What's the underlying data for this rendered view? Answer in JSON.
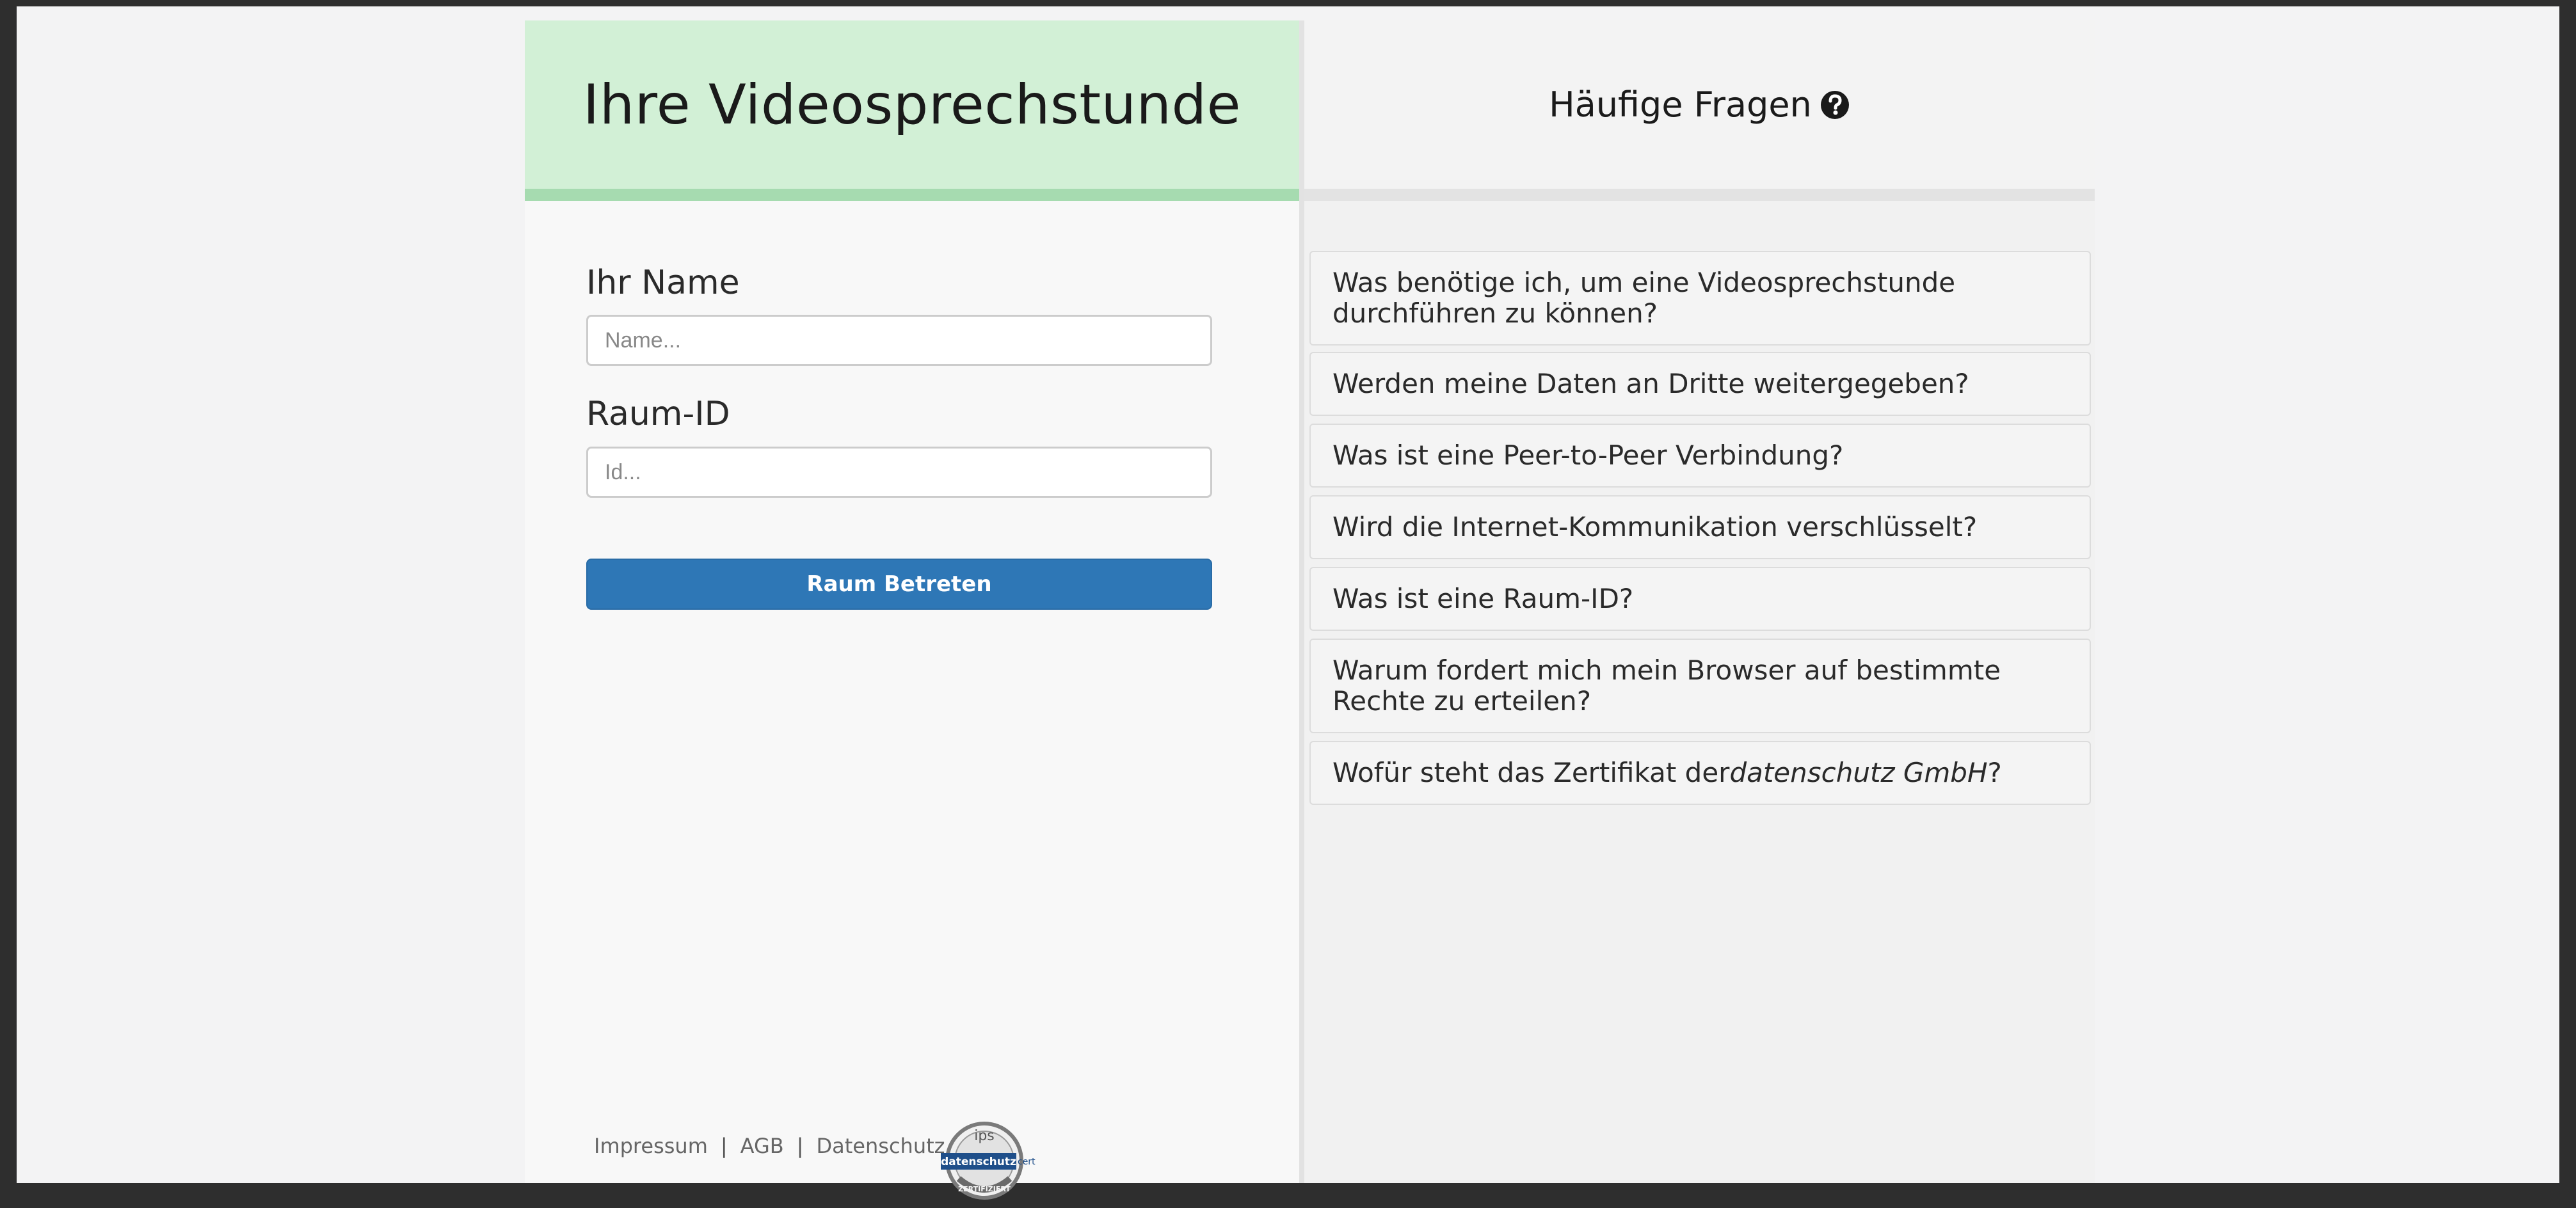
{
  "app": {
    "title": "Ihre Videosprechstunde"
  },
  "form": {
    "name_label": "Ihr Name",
    "name_placeholder": "Name...",
    "name_value": "",
    "room_label": "Raum-ID",
    "room_placeholder": "Id...",
    "room_value": "",
    "submit_label": "Raum Betreten"
  },
  "footer": {
    "links": [
      "Impressum",
      "AGB",
      "Datenschutz"
    ],
    "separator": "|",
    "seal_top_text": "ips",
    "seal_band_text": "datenschutz",
    "seal_side_text": "cert",
    "seal_bottom_text": "ZERTIFIZIERT"
  },
  "faq": {
    "title": "Häufige Fragen",
    "items": [
      "Was benötige ich, um eine Videosprechstunde durchführen zu können?",
      "Werden meine Daten an Dritte weitergegeben?",
      "Was ist eine Peer-to-Peer Verbindung?",
      "Wird die Internet-Kommunikation verschlüsselt?",
      "Was ist eine Raum-ID?",
      "Warum fordert mich mein Browser auf bestimmte Rechte zu erteilen?",
      "Wofür steht das Zertifikat der datenschutz GmbH?"
    ]
  },
  "colors": {
    "header_green": "#d2f0d6",
    "header_green_border": "#a6dbb0",
    "primary_button": "#2e77b6"
  },
  "icons": {
    "faq_help": "question-circle-icon",
    "seal": "datenschutz-cert-seal"
  }
}
